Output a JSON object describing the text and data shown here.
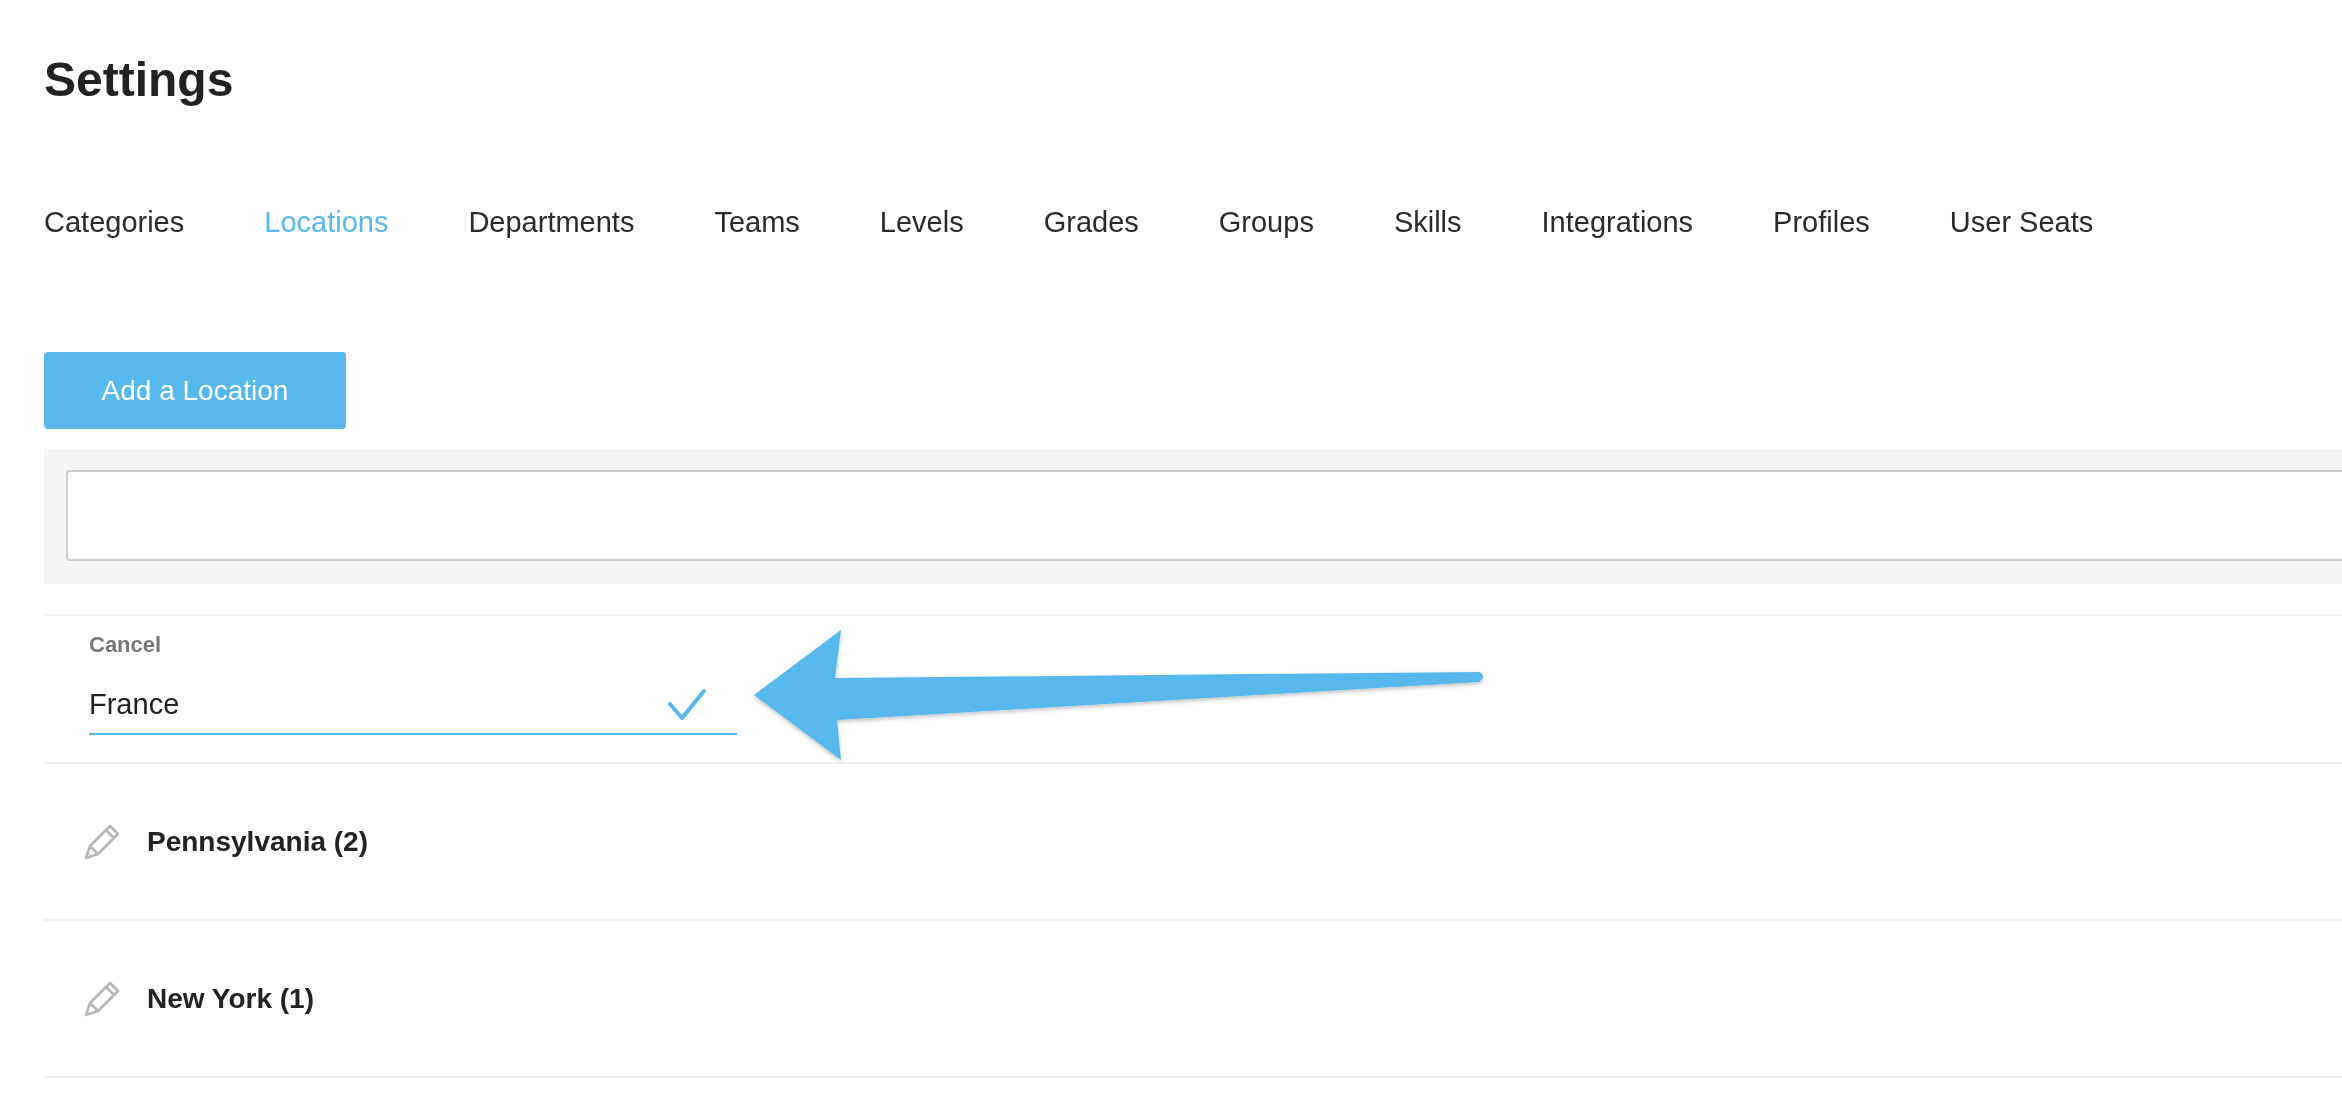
{
  "title": "Settings",
  "tabs": [
    {
      "label": "Categories",
      "selected": false
    },
    {
      "label": "Locations",
      "selected": true
    },
    {
      "label": "Departments",
      "selected": false
    },
    {
      "label": "Teams",
      "selected": false
    },
    {
      "label": "Levels",
      "selected": false
    },
    {
      "label": "Grades",
      "selected": false
    },
    {
      "label": "Groups",
      "selected": false
    },
    {
      "label": "Skills",
      "selected": false
    },
    {
      "label": "Integrations",
      "selected": false
    },
    {
      "label": "Profiles",
      "selected": false
    },
    {
      "label": "User Seats",
      "selected": false
    }
  ],
  "add_button": "Add a Location",
  "editor": {
    "cancel": "Cancel",
    "value": "France"
  },
  "locations": [
    {
      "name": "Pennsylvania (2)"
    },
    {
      "name": "New York (1)"
    }
  ]
}
